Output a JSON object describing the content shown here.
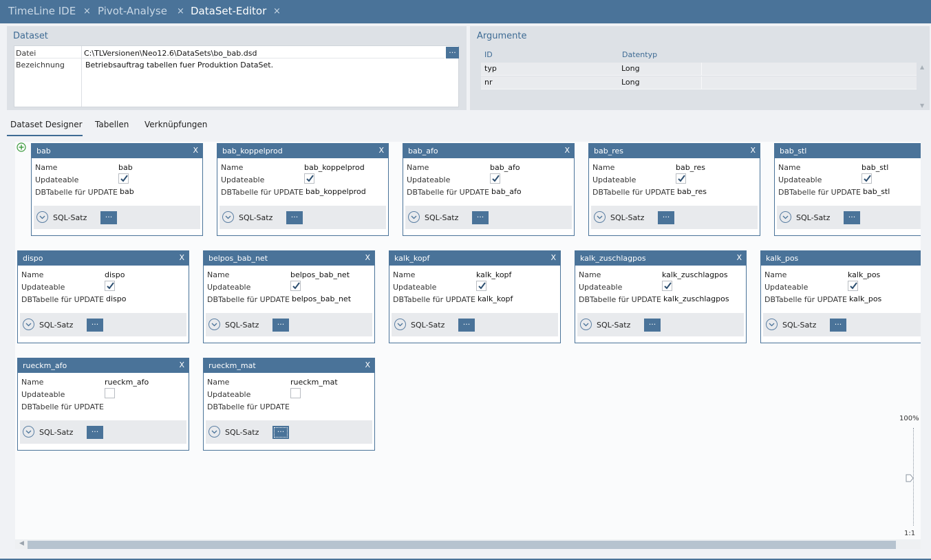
{
  "top_tabs": [
    {
      "label": "TimeLine IDE"
    },
    {
      "label": "Pivot-Analyse"
    },
    {
      "label": "DataSet-Editor"
    }
  ],
  "close_glyph": "×",
  "dataset": {
    "title": "Dataset",
    "file_label": "Datei",
    "file_value": "C:\\TLVersionen\\Neo12.6\\DataSets\\bo_bab.dsd",
    "desc_label": "Bezeichnung",
    "desc_value": "Betriebsauftrag tabellen fuer Produktion DataSet.",
    "browse_label": "..."
  },
  "arguments": {
    "title": "Argumente",
    "headers": {
      "id": "ID",
      "type": "Datentyp"
    },
    "rows": [
      {
        "id": "typ",
        "type": "Long"
      },
      {
        "id": "nr",
        "type": "Long"
      }
    ]
  },
  "designer_tabs": [
    "Dataset Designer",
    "Tabellen",
    "Verknüpfungen"
  ],
  "card_labels": {
    "name": "Name",
    "updateable": "Updateable",
    "dbtable": "DBTabelle für UPDATE",
    "sql": "SQL-Satz",
    "sql_button": "...",
    "close": "X"
  },
  "tables": [
    {
      "title": "bab",
      "name": "bab",
      "updateable": true,
      "dbtable": "bab"
    },
    {
      "title": "bab_koppelprod",
      "name": "bab_koppelprod",
      "updateable": true,
      "dbtable": "bab_koppelprod"
    },
    {
      "title": "bab_afo",
      "name": "bab_afo",
      "updateable": true,
      "dbtable": "bab_afo"
    },
    {
      "title": "bab_res",
      "name": "bab_res",
      "updateable": true,
      "dbtable": "bab_res"
    },
    {
      "title": "bab_stl",
      "name": "bab_stl",
      "updateable": true,
      "dbtable": "bab_stl"
    },
    {
      "title": "dispo",
      "name": "dispo",
      "updateable": true,
      "dbtable": "dispo"
    },
    {
      "title": "belpos_bab_net",
      "name": "belpos_bab_net",
      "updateable": true,
      "dbtable": "belpos_bab_net"
    },
    {
      "title": "kalk_kopf",
      "name": "kalk_kopf",
      "updateable": true,
      "dbtable": "kalk_kopf"
    },
    {
      "title": "kalk_zuschlagpos",
      "name": "kalk_zuschlagpos",
      "updateable": true,
      "dbtable": "kalk_zuschlagpos"
    },
    {
      "title": "kalk_pos",
      "name": "kalk_pos",
      "updateable": true,
      "dbtable": "kalk_pos"
    },
    {
      "title": "rueckm_afo",
      "name": "rueckm_afo",
      "updateable": false,
      "dbtable": ""
    },
    {
      "title": "rueckm_mat",
      "name": "rueckm_mat",
      "updateable": false,
      "dbtable": ""
    }
  ],
  "zoom": {
    "level": "100%",
    "ratio": "1:1"
  },
  "colors": {
    "accent": "#4a7399",
    "panel": "#dde1e6",
    "canvas": "#fafbfc"
  }
}
